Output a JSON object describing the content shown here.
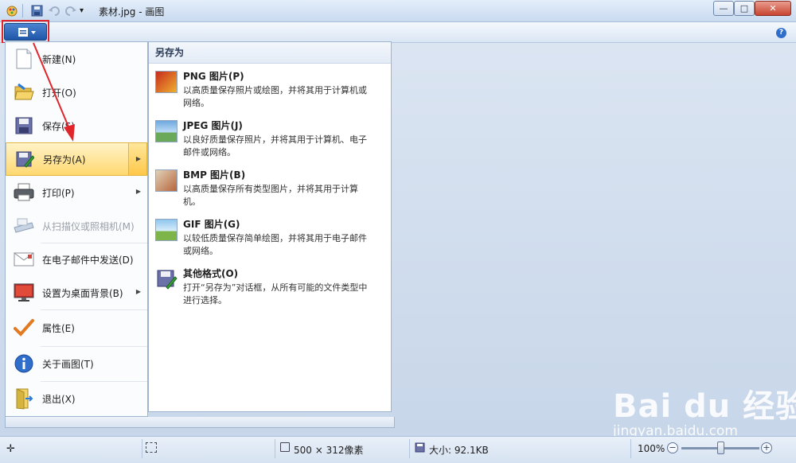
{
  "window": {
    "title": "素材.jpg - 画图",
    "minimize_glyph": "—",
    "maximize_glyph": "□",
    "close_glyph": "✕"
  },
  "quick_access": {
    "icons": [
      "paint-icon",
      "save-icon",
      "undo-icon",
      "redo-icon",
      "customize-dropdown-icon"
    ]
  },
  "ribbon": {
    "help_glyph": "?"
  },
  "menu": {
    "items": [
      {
        "label": "新建(N)",
        "icon": "new-file-icon",
        "submenu": false,
        "enabled": true
      },
      {
        "label": "打开(O)",
        "icon": "open-folder-icon",
        "submenu": false,
        "enabled": true
      },
      {
        "label": "保存(S)",
        "icon": "save-icon",
        "submenu": false,
        "enabled": true
      },
      {
        "label": "另存为(A)",
        "icon": "save-as-icon",
        "submenu": true,
        "enabled": true,
        "highlighted": true
      },
      {
        "label": "打印(P)",
        "icon": "printer-icon",
        "submenu": true,
        "enabled": true
      },
      {
        "label": "从扫描仪或照相机(M)",
        "icon": "scanner-icon",
        "submenu": false,
        "enabled": false
      },
      {
        "label": "在电子邮件中发送(D)",
        "icon": "email-icon",
        "submenu": false,
        "enabled": true
      },
      {
        "label": "设置为桌面背景(B)",
        "icon": "desktop-background-icon",
        "submenu": true,
        "enabled": true
      },
      {
        "label": "属性(E)",
        "icon": "checkmark-icon",
        "submenu": false,
        "enabled": true
      },
      {
        "label": "关于画图(T)",
        "icon": "info-icon",
        "submenu": false,
        "enabled": true
      },
      {
        "label": "退出(X)",
        "icon": "exit-icon",
        "submenu": false,
        "enabled": true
      }
    ]
  },
  "submenu": {
    "title": "另存为",
    "items": [
      {
        "title": "PNG 图片(P)",
        "desc": "以高质量保存照片或绘图，并将其用于计算机或网络。",
        "icon": "png-image-icon"
      },
      {
        "title": "JPEG 图片(J)",
        "desc": "以良好质量保存照片，并将其用于计算机、电子邮件或网络。",
        "icon": "jpeg-image-icon"
      },
      {
        "title": "BMP 图片(B)",
        "desc": "以高质量保存所有类型图片，并将其用于计算机。",
        "icon": "bmp-image-icon"
      },
      {
        "title": "GIF 图片(G)",
        "desc": "以较低质量保存简单绘图，并将其用于电子邮件或网络。",
        "icon": "gif-image-icon"
      },
      {
        "title": "其他格式(O)",
        "desc": "打开“另存为”对话框，从所有可能的文件类型中进行选择。",
        "icon": "other-formats-icon"
      }
    ]
  },
  "status": {
    "dimensions": "500 × 312像素",
    "size": "大小: 92.1KB",
    "zoom": "100%",
    "zoom_level_fraction": 0.5
  },
  "watermark": {
    "logo": "Bai du 经验",
    "url": "jingyan.baidu.com"
  },
  "colors": {
    "highlight": "#ffd870",
    "annotation_red": "#e0262b",
    "menu_button": "#2a63b8"
  }
}
